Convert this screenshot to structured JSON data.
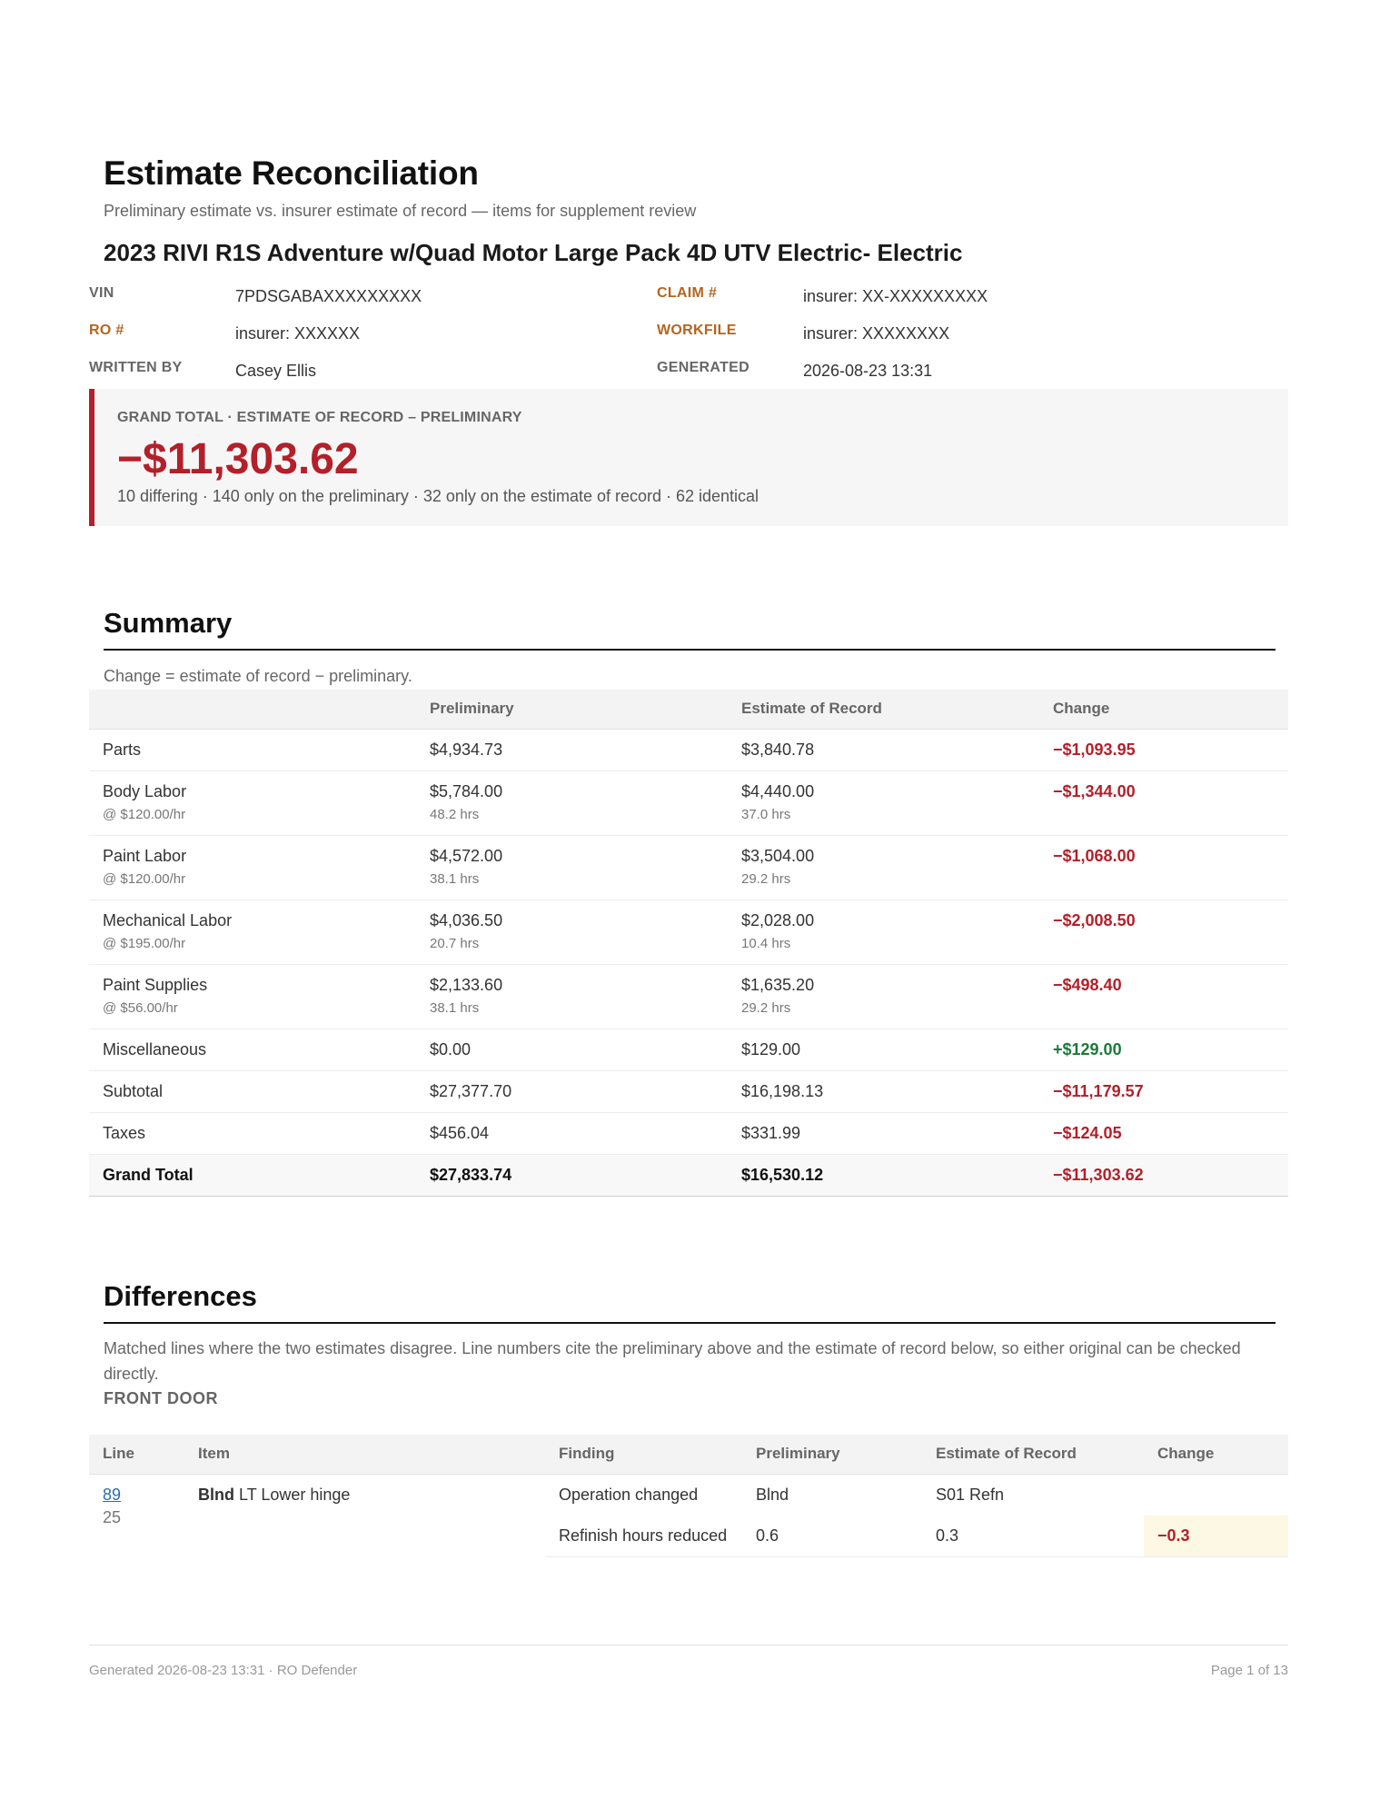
{
  "header": {
    "title": "Estimate Reconciliation",
    "subtitle": "Preliminary estimate vs. insurer estimate of record — items for supplement review",
    "vehicle": "2023 RIVI R1S Adventure w/Quad Motor Large Pack 4D UTV Electric- Electric"
  },
  "meta": {
    "vin_label": "VIN",
    "vin": "7PDSGABAXXXXXXXXX",
    "claim_label": "CLAIM #",
    "claim": "insurer: XX-XXXXXXXXX",
    "ro_label": "RO #",
    "ro": "insurer: XXXXXX",
    "workfile_label": "WORKFILE",
    "workfile": "insurer: XXXXXXXX",
    "written_by_label": "WRITTEN BY",
    "written_by": "Casey Ellis",
    "generated_label": "GENERATED",
    "generated": "2026-08-23 13:31"
  },
  "grand_total": {
    "label": "GRAND TOTAL · ESTIMATE OF RECORD – PRELIMINARY",
    "value": "−$11,303.62",
    "note": "10 differing · 140 only on the preliminary · 32 only on the estimate of record · 62 identical"
  },
  "summary": {
    "heading": "Summary",
    "note": "Change = estimate of record − preliminary.",
    "columns": [
      "",
      "Preliminary",
      "Estimate of Record",
      "Change"
    ],
    "rows": [
      {
        "name": "Parts",
        "sub": "",
        "prelim": "$4,934.73",
        "prelim_sub": "",
        "eor": "$3,840.78",
        "eor_sub": "",
        "change": "−$1,093.95"
      },
      {
        "name": "Body Labor",
        "sub": "@ $120.00/hr",
        "prelim": "$5,784.00",
        "prelim_sub": "48.2 hrs",
        "eor": "$4,440.00",
        "eor_sub": "37.0 hrs",
        "change": "−$1,344.00"
      },
      {
        "name": "Paint Labor",
        "sub": "@ $120.00/hr",
        "prelim": "$4,572.00",
        "prelim_sub": "38.1 hrs",
        "eor": "$3,504.00",
        "eor_sub": "29.2 hrs",
        "change": "−$1,068.00"
      },
      {
        "name": "Mechanical Labor",
        "sub": "@ $195.00/hr",
        "prelim": "$4,036.50",
        "prelim_sub": "20.7 hrs",
        "eor": "$2,028.00",
        "eor_sub": "10.4 hrs",
        "change": "−$2,008.50"
      },
      {
        "name": "Paint Supplies",
        "sub": "@ $56.00/hr",
        "prelim": "$2,133.60",
        "prelim_sub": "38.1 hrs",
        "eor": "$1,635.20",
        "eor_sub": "29.2 hrs",
        "change": "−$498.40"
      },
      {
        "name": "Miscellaneous",
        "sub": "",
        "prelim": "$0.00",
        "prelim_sub": "",
        "eor": "$129.00",
        "eor_sub": "",
        "change": "+$129.00"
      },
      {
        "name": "Subtotal",
        "sub": "",
        "prelim": "$27,377.70",
        "prelim_sub": "",
        "eor": "$16,198.13",
        "eor_sub": "",
        "change": "−$11,179.57"
      },
      {
        "name": "Taxes",
        "sub": "",
        "prelim": "$456.04",
        "prelim_sub": "",
        "eor": "$331.99",
        "eor_sub": "",
        "change": "−$124.05"
      }
    ],
    "total": {
      "name": "Grand Total",
      "prelim": "$27,833.74",
      "eor": "$16,530.12",
      "change": "−$11,303.62"
    }
  },
  "differences": {
    "heading": "Differences",
    "note": "Matched lines where the two estimates disagree. Line numbers cite the preliminary above and the estimate of record below, so either original can be checked directly.",
    "group": "FRONT DOOR",
    "columns": [
      "Line",
      "Item",
      "Finding",
      "Preliminary",
      "Estimate of Record",
      "Change"
    ],
    "item": {
      "line_prelim": "89",
      "line_eor": "25",
      "op": "Blnd",
      "name": "LT Lower hinge",
      "findings": [
        {
          "finding": "Operation changed",
          "prelim": "Blnd",
          "eor": "S01 Refn",
          "change": ""
        },
        {
          "finding": "Refinish hours reduced",
          "prelim": "0.6",
          "eor": "0.3",
          "change": "−0.3"
        }
      ]
    }
  },
  "footer": {
    "left": "Generated 2026-08-23 13:31 · RO Defender",
    "right": "Page 1 of 13"
  }
}
